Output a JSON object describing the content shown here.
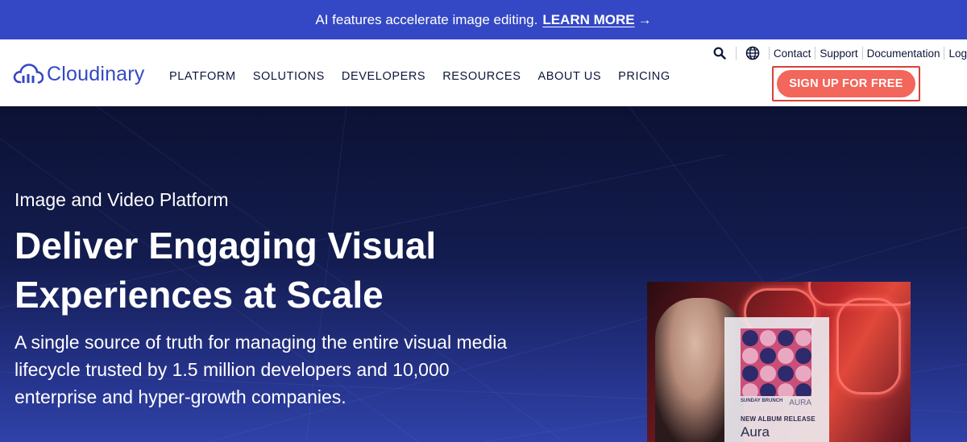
{
  "promo": {
    "text": "AI features accelerate image editing.",
    "link_label": "LEARN MORE",
    "arrow": "→"
  },
  "header": {
    "logo_text": "Cloudinary",
    "logo_icon": "cloudinary-cloud-icon",
    "nav": [
      {
        "label": "PLATFORM"
      },
      {
        "label": "SOLUTIONS"
      },
      {
        "label": "DEVELOPERS"
      },
      {
        "label": "RESOURCES"
      },
      {
        "label": "ABOUT US"
      },
      {
        "label": "PRICING"
      }
    ],
    "utility": {
      "search_icon": "search-icon",
      "globe_icon": "globe-icon",
      "links": [
        "Contact",
        "Support",
        "Documentation",
        "Log"
      ]
    },
    "signup_label": "SIGN UP FOR FREE"
  },
  "hero": {
    "eyebrow": "Image and Video Platform",
    "title_line1": "Deliver Engaging Visual",
    "title_line2": "Experiences at Scale",
    "description": "A single source of truth for managing the entire visual media lifecycle trusted by 1.5 million developers and 10,000 enterprise and hyper-growth companies.",
    "media": {
      "brand": "SUNDAY BRUNCH",
      "art_name": "AURA",
      "label": "NEW ALBUM RELEASE",
      "title": "Aura"
    }
  },
  "colors": {
    "promo_bg": "#3448c5",
    "brand_blue": "#3448c5",
    "nav_text": "#0c163b",
    "signup_bg": "#f2665b",
    "highlight_border": "#d8403a",
    "hero_top": "#0c1233",
    "hero_bottom": "#2f42a8"
  }
}
